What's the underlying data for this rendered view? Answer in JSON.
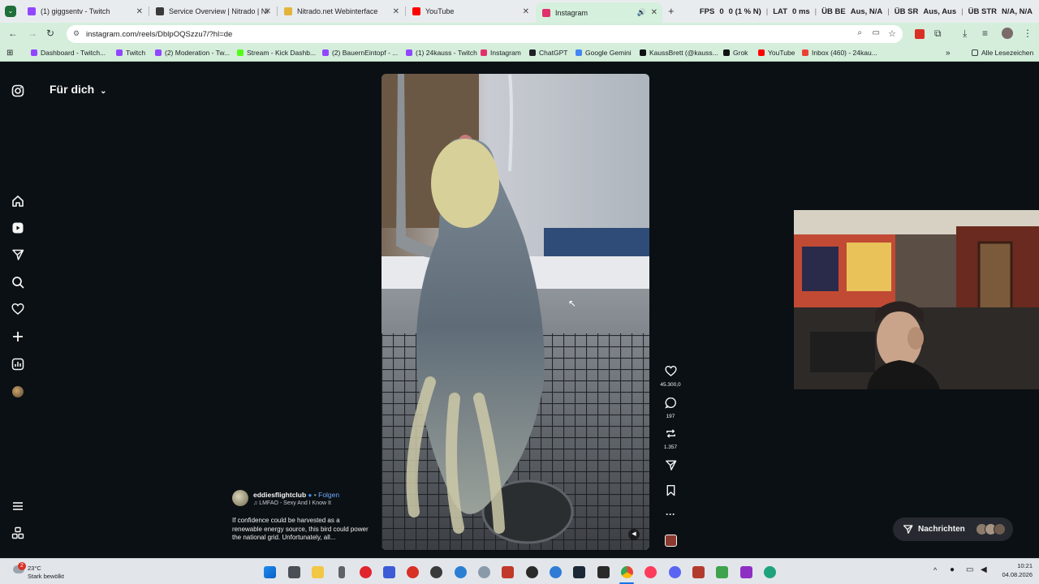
{
  "tabs": [
    {
      "title": "(1) giggsentv - Twitch",
      "color": "#9146ff"
    },
    {
      "title": "Service Overview | Nitrado | Ni",
      "color": "#3a3a3a"
    },
    {
      "title": "Nitrado.net Webinterface",
      "color": "#e2b43b"
    },
    {
      "title": "YouTube",
      "color": "#ff0000"
    },
    {
      "title": "Instagram",
      "color": "#e1306c",
      "active": true
    }
  ],
  "overlay": {
    "fps_label": "FPS",
    "fps_value": "0",
    "fps_detail": "0 (1 % N)",
    "lat_label": "LAT",
    "lat_value": "0 ms",
    "ub_be_label": "ÜB BE",
    "ub_be_value": "Aus, N/A",
    "ub_sr_label": "ÜB SR",
    "ub_sr_value": "Aus, Aus",
    "ub_str_label": "ÜB STR",
    "ub_str_value": "N/A, N/A"
  },
  "address": {
    "url": "instagram.com/reels/DblpOQSzzu7/?hl=de"
  },
  "bookmarks": [
    {
      "label": "Dashboard - Twitch...",
      "color": "#9146ff"
    },
    {
      "label": "Twitch",
      "color": "#9146ff"
    },
    {
      "label": "(2) Moderation - Tw...",
      "color": "#9146ff"
    },
    {
      "label": "Stream - Kick Dashb...",
      "color": "#53fc18"
    },
    {
      "label": "(2) BauernEintopf - ...",
      "color": "#9146ff"
    },
    {
      "label": "(1) 24kauss - Twitch",
      "color": "#9146ff"
    },
    {
      "label": "Instagram",
      "color": "#e1306c"
    },
    {
      "label": "ChatGPT",
      "color": "#202124"
    },
    {
      "label": "Google Gemini",
      "color": "#4285f4"
    },
    {
      "label": "KaussBrett (@kauss...",
      "color": "#111111"
    },
    {
      "label": "Grok",
      "color": "#111111"
    },
    {
      "label": "YouTube",
      "color": "#ff0000"
    },
    {
      "label": "Inbox (460) - 24kau...",
      "color": "#ea4335"
    }
  ],
  "bookmarks_all": "Alle Lesezeichen",
  "instagram": {
    "feed_title": "Für dich",
    "likes": "45.300,0",
    "comments": "197",
    "reposts": "1.357",
    "author": "eddiesflightclub",
    "follow": "Folgen",
    "audio": "LMFAO - Sexy And I Know It",
    "caption": "If confidence could be harvested as a renewable energy source, this bird could power the national grid. Unfortunately, all...",
    "messages_label": "Nachrichten"
  },
  "taskbar": {
    "weather_temp": "23°C",
    "weather_desc": "Stark bewölkt",
    "notification_count": "2",
    "time": "10:21",
    "date": "04.08.2026"
  }
}
